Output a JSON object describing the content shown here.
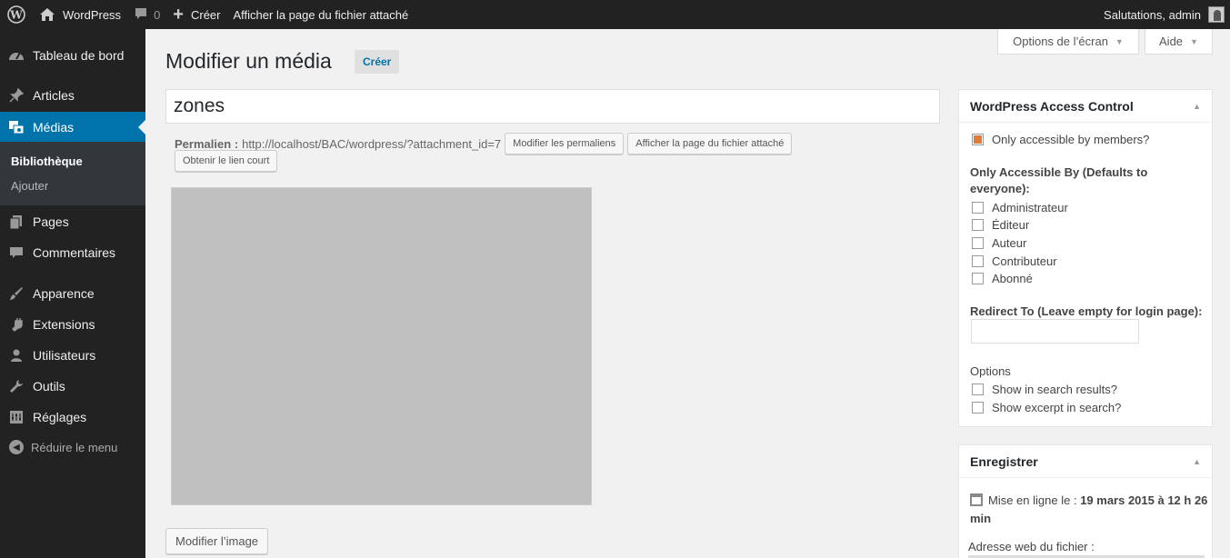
{
  "adminbar": {
    "site_name": "WordPress",
    "comments_count": "0",
    "new_label": "Créer",
    "view_attachment": "Afficher la page du fichier attaché",
    "greeting": "Salutations, admin"
  },
  "sidebar": {
    "items": [
      {
        "label": "Tableau de bord",
        "icon": "dashboard-icon"
      },
      {
        "label": "Articles",
        "icon": "pin-icon"
      },
      {
        "label": "Médias",
        "icon": "media-icon"
      },
      {
        "label": "Pages",
        "icon": "pages-icon"
      },
      {
        "label": "Commentaires",
        "icon": "comments-icon"
      },
      {
        "label": "Apparence",
        "icon": "brush-icon"
      },
      {
        "label": "Extensions",
        "icon": "plugin-icon"
      },
      {
        "label": "Utilisateurs",
        "icon": "users-icon"
      },
      {
        "label": "Outils",
        "icon": "wrench-icon"
      },
      {
        "label": "Réglages",
        "icon": "settings-icon"
      }
    ],
    "submenu": [
      "Bibliothèque",
      "Ajouter"
    ],
    "collapse_label": "Réduire le menu"
  },
  "screen_options": {
    "options_label": "Options de l’écran",
    "help_label": "Aide"
  },
  "main": {
    "title": "Modifier un média",
    "add_new": "Créer",
    "media_title": "zones",
    "permalink_label": "Permalien :",
    "permalink_url": "http://localhost/BAC/wordpress/?attachment_id=7",
    "edit_permalink_btn": "Modifier les permaliens",
    "view_attachment_btn": "Afficher la page du fichier attaché",
    "shortlink_btn": "Obtenir le lien court",
    "edit_image_btn": "Modifier l’image"
  },
  "access_control": {
    "title": "WordPress Access Control",
    "members_only": "Only accessible by members?",
    "accessible_by": "Only Accessible By (Defaults to everyone):",
    "roles": [
      "Administrateur",
      "Éditeur",
      "Auteur",
      "Contributeur",
      "Abonné"
    ],
    "redirect_label": "Redirect To (Leave empty for login page):",
    "options_label": "Options",
    "show_search": "Show in search results?",
    "show_excerpt": "Show excerpt in search?"
  },
  "publish": {
    "title": "Enregistrer",
    "published_label": "Mise en ligne le :",
    "published_date": "19 mars 2015 à 12 h 26 min",
    "file_url_label": "Adresse web du fichier :"
  }
}
